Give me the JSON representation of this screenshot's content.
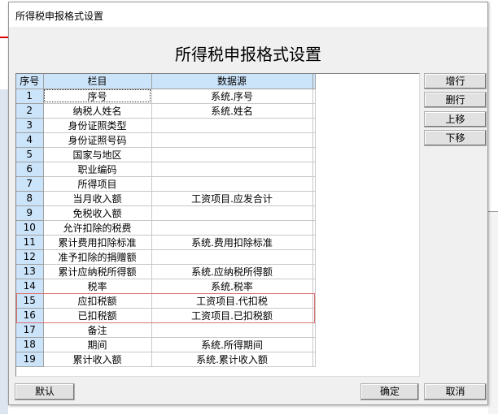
{
  "window": {
    "title": "所得税申报格式设置",
    "heading": "所得税申报格式设置"
  },
  "grid": {
    "headers": [
      "序号",
      "栏目",
      "数据源"
    ],
    "rows": [
      [
        "1",
        "序号",
        "系统.序号"
      ],
      [
        "2",
        "纳税人姓名",
        "系统.姓名"
      ],
      [
        "3",
        "身份证照类型",
        ""
      ],
      [
        "4",
        "身份证照号码",
        ""
      ],
      [
        "5",
        "国家与地区",
        ""
      ],
      [
        "6",
        "职业编码",
        ""
      ],
      [
        "7",
        "所得项目",
        ""
      ],
      [
        "8",
        "当月收入额",
        "工资项目.应发合计"
      ],
      [
        "9",
        "免税收入额",
        ""
      ],
      [
        "10",
        "允许扣除的税费",
        ""
      ],
      [
        "11",
        "累计费用扣除标准",
        "系统.费用扣除标准"
      ],
      [
        "12",
        "准予扣除的捐赠额",
        ""
      ],
      [
        "13",
        "累计应纳税所得额",
        "系统.应纳税所得额"
      ],
      [
        "14",
        "税率",
        "系统.税率"
      ],
      [
        "15",
        "应扣税额",
        "工资项目.代扣税"
      ],
      [
        "16",
        "已扣税额",
        "工资项目.已扣税额"
      ],
      [
        "17",
        "备注",
        ""
      ],
      [
        "18",
        "期间",
        "系统.所得期间"
      ],
      [
        "19",
        "累计收入额",
        "系统.累计收入额"
      ]
    ]
  },
  "buttons": {
    "add_row": "增行",
    "delete_row": "删行",
    "move_up": "上移",
    "move_down": "下移",
    "default": "默认",
    "ok": "确定",
    "cancel": "取消"
  }
}
